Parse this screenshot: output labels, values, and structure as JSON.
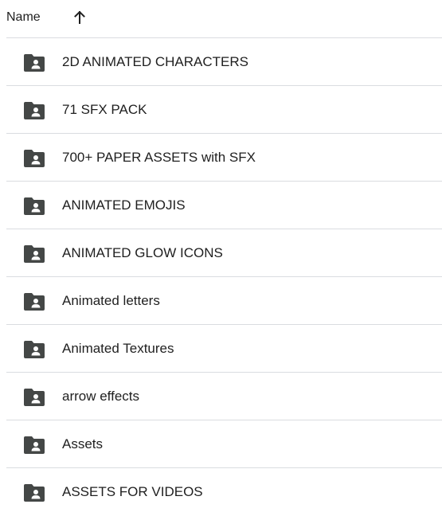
{
  "header": {
    "name_label": "Name",
    "sort_icon": "arrow-up-icon"
  },
  "folder_icon": "shared-folder-icon",
  "items": [
    {
      "label": "2D ANIMATED CHARACTERS"
    },
    {
      "label": "71 SFX PACK"
    },
    {
      "label": "700+ PAPER ASSETS with SFX"
    },
    {
      "label": "ANIMATED EMOJIS"
    },
    {
      "label": "ANIMATED GLOW ICONS"
    },
    {
      "label": "Animated letters"
    },
    {
      "label": "Animated Textures"
    },
    {
      "label": "arrow effects"
    },
    {
      "label": "Assets"
    },
    {
      "label": "ASSETS FOR VIDEOS"
    }
  ],
  "colors": {
    "icon": "#444746",
    "divider": "#dadce0",
    "text": "#1f1f1f"
  }
}
